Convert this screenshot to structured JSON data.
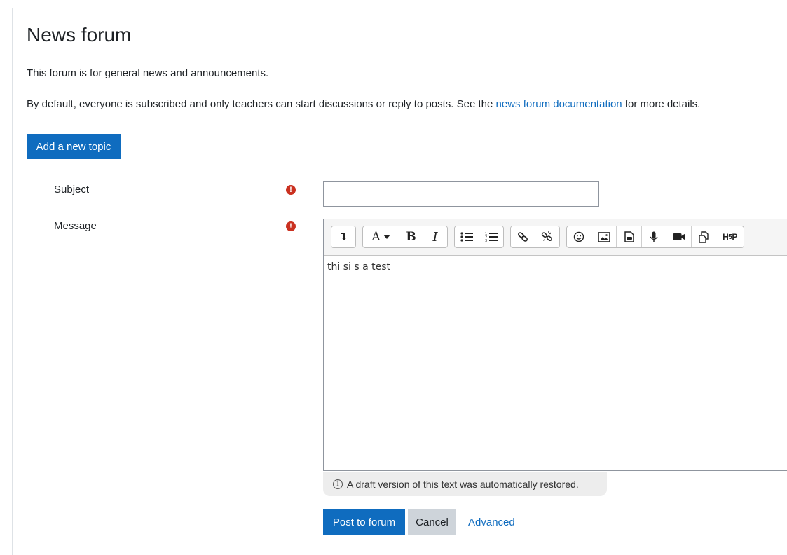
{
  "page": {
    "title": "News forum",
    "intro_line1": "This forum is for general news and announcements.",
    "intro_line2_before": "By default, everyone is subscribed and only teachers can start discussions or reply to posts. See the ",
    "intro_link": "news forum documentation",
    "intro_line2_after": " for more details."
  },
  "add_topic_button": "Add a new topic",
  "form": {
    "subject_label": "Subject",
    "subject_value": "",
    "message_label": "Message",
    "required_icon": "exclamation-circle-icon",
    "message_content": "thi si s a test",
    "draft_notice": "A draft version of this text was automatically restored."
  },
  "toolbar": {
    "groups": [
      [
        "collapse-icon"
      ],
      [
        "paragraph-styles-icon",
        "bold-icon",
        "italic-icon"
      ],
      [
        "unordered-list-icon",
        "ordered-list-icon"
      ],
      [
        "link-icon",
        "unlink-icon"
      ],
      [
        "emoji-icon",
        "image-icon",
        "media-icon",
        "record-audio-icon",
        "record-video-icon",
        "manage-files-icon",
        "h5p-icon"
      ]
    ]
  },
  "buttons": {
    "post": "Post to forum",
    "cancel": "Cancel",
    "advanced": "Advanced"
  },
  "colors": {
    "primary": "#0f6cbf",
    "required": "#ca3120",
    "secondary": "#ced4da"
  }
}
